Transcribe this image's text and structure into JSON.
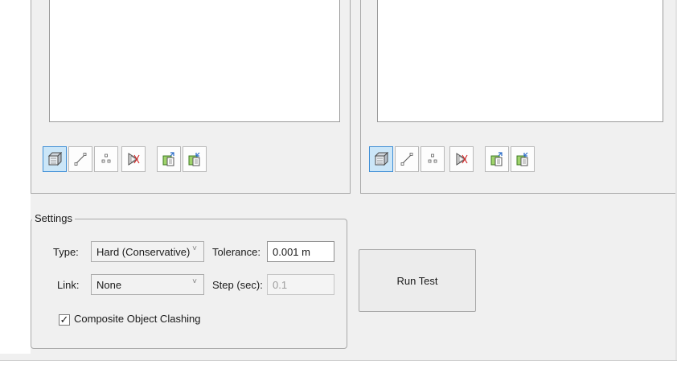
{
  "left_panel": {
    "toolbar": [
      {
        "icon": "selection-box-icon",
        "active": true
      },
      {
        "icon": "line-icon",
        "active": false
      },
      {
        "icon": "points-icon",
        "active": false
      },
      {
        "icon": "clash-exclude-icon",
        "active": false
      },
      {
        "icon": "import-selection-icon",
        "active": false
      },
      {
        "icon": "export-selection-icon",
        "active": false
      }
    ]
  },
  "right_panel": {
    "toolbar": [
      {
        "icon": "selection-box-icon",
        "active": true
      },
      {
        "icon": "line-icon",
        "active": false
      },
      {
        "icon": "points-icon",
        "active": false
      },
      {
        "icon": "clash-exclude-icon",
        "active": false
      },
      {
        "icon": "import-selection-icon",
        "active": false
      },
      {
        "icon": "export-selection-icon",
        "active": false
      }
    ]
  },
  "settings": {
    "legend": "Settings",
    "type_label": "Type:",
    "type_value": "Hard (Conservative)",
    "tolerance_label": "Tolerance:",
    "tolerance_value": "0.001 m",
    "link_label": "Link:",
    "link_value": "None",
    "step_label": "Step (sec):",
    "step_value": "0.1",
    "composite_label": "Composite Object Clashing",
    "composite_checked": true,
    "check_mark": "✓",
    "chevron": "˅"
  },
  "run_test_label": "Run Test",
  "colors": {
    "active_button_bg": "#cbe6f8",
    "active_button_border": "#3e8ed6",
    "window_bg": "#f0f0f0"
  }
}
